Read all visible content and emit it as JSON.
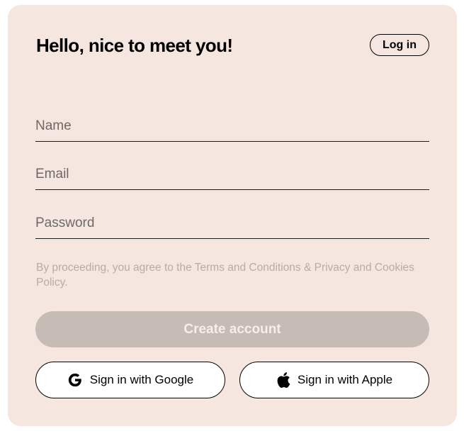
{
  "header": {
    "title": "Hello, nice to meet you!",
    "login_label": "Log in"
  },
  "form": {
    "name_placeholder": "Name",
    "name_value": "",
    "email_placeholder": "Email",
    "email_value": "",
    "password_placeholder": "Password",
    "password_value": ""
  },
  "legal": {
    "text": "By proceeding, you agree to the Terms and Conditions & Privacy and Cookies Policy."
  },
  "actions": {
    "create_account_label": "Create account",
    "google_label": "Sign in with Google",
    "apple_label": "Sign in with Apple"
  },
  "icons": {
    "google": "google-icon",
    "apple": "apple-icon"
  },
  "colors": {
    "card_background": "#f6e6e0",
    "disabled_button": "#c6bbb5",
    "legal_text": "#b9aba7"
  }
}
